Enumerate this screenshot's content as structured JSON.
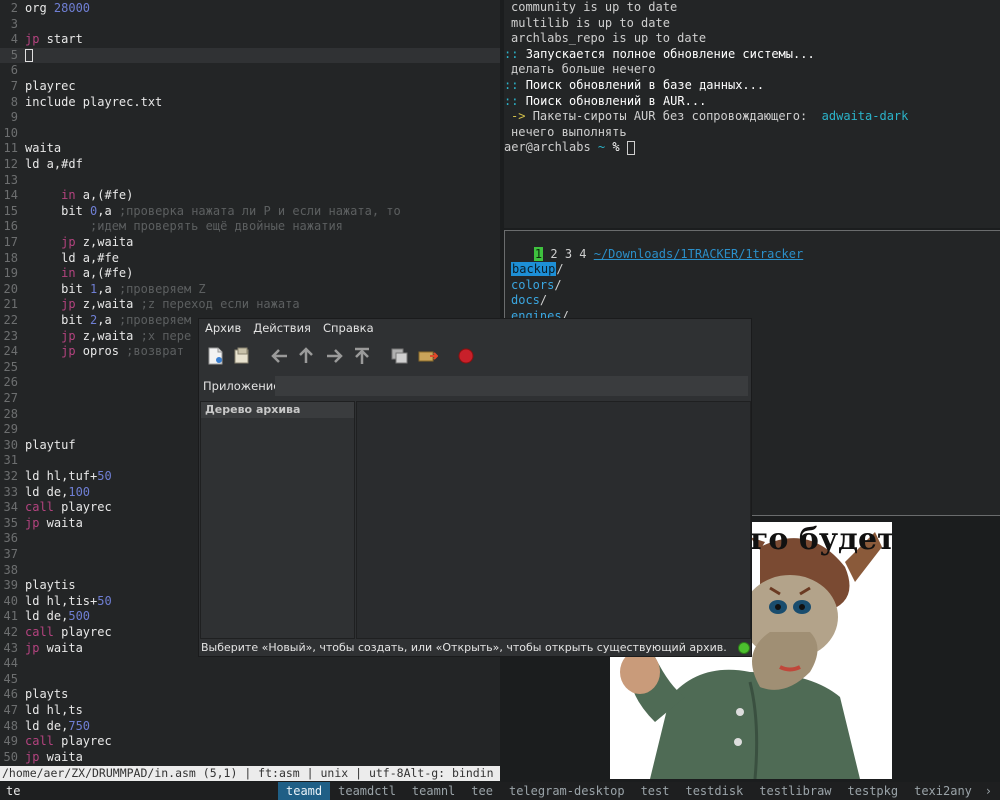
{
  "editor": {
    "lines": [
      {
        "n": "2",
        "parts": [
          [
            "t",
            "org "
          ],
          [
            "num",
            "28000"
          ]
        ]
      },
      {
        "n": "3",
        "parts": []
      },
      {
        "n": "4",
        "parts": [
          [
            "kw",
            "jp"
          ],
          [
            "t",
            " start"
          ]
        ]
      },
      {
        "n": "5",
        "parts": [
          [
            "cursor",
            ""
          ]
        ],
        "current": true
      },
      {
        "n": "6",
        "parts": []
      },
      {
        "n": "7",
        "parts": [
          [
            "t",
            "playrec"
          ]
        ]
      },
      {
        "n": "8",
        "parts": [
          [
            "t",
            "include playrec.txt"
          ]
        ]
      },
      {
        "n": "9",
        "parts": []
      },
      {
        "n": "10",
        "parts": []
      },
      {
        "n": "11",
        "parts": [
          [
            "t",
            "waita"
          ]
        ]
      },
      {
        "n": "12",
        "parts": [
          [
            "t",
            "ld a,#df"
          ]
        ]
      },
      {
        "n": "13",
        "parts": []
      },
      {
        "n": "14",
        "parts": [
          [
            "t",
            "     "
          ],
          [
            "kw",
            "in"
          ],
          [
            "t",
            " a,(#fe)"
          ]
        ]
      },
      {
        "n": "15",
        "parts": [
          [
            "t",
            "     bit "
          ],
          [
            "num",
            "0"
          ],
          [
            "t",
            ",a "
          ],
          [
            "cmt",
            ";проверка нажата ли P и если нажата, то"
          ]
        ]
      },
      {
        "n": "16",
        "parts": [
          [
            "t",
            "         "
          ],
          [
            "cmt",
            ";идем проверять ещё двойные нажатия"
          ]
        ]
      },
      {
        "n": "17",
        "parts": [
          [
            "t",
            "     "
          ],
          [
            "kw",
            "jp"
          ],
          [
            "t",
            " z,waita"
          ]
        ]
      },
      {
        "n": "18",
        "parts": [
          [
            "t",
            "     ld a,#fe"
          ]
        ]
      },
      {
        "n": "19",
        "parts": [
          [
            "t",
            "     "
          ],
          [
            "kw",
            "in"
          ],
          [
            "t",
            " a,(#fe)"
          ]
        ]
      },
      {
        "n": "20",
        "parts": [
          [
            "t",
            "     bit "
          ],
          [
            "num",
            "1"
          ],
          [
            "t",
            ",a "
          ],
          [
            "cmt",
            ";проверяем Z"
          ]
        ]
      },
      {
        "n": "21",
        "parts": [
          [
            "t",
            "     "
          ],
          [
            "kw",
            "jp"
          ],
          [
            "t",
            " z,waita "
          ],
          [
            "cmt",
            ";z переход если нажата"
          ]
        ]
      },
      {
        "n": "22",
        "parts": [
          [
            "t",
            "     bit "
          ],
          [
            "num",
            "2"
          ],
          [
            "t",
            ",a "
          ],
          [
            "cmt",
            ";проверяем"
          ]
        ]
      },
      {
        "n": "23",
        "parts": [
          [
            "t",
            "     "
          ],
          [
            "kw",
            "jp"
          ],
          [
            "t",
            " z,waita "
          ],
          [
            "cmt",
            ";x пере"
          ]
        ]
      },
      {
        "n": "24",
        "parts": [
          [
            "t",
            "     "
          ],
          [
            "kw",
            "jp"
          ],
          [
            "t",
            " opros "
          ],
          [
            "cmt",
            ";возврат"
          ]
        ]
      },
      {
        "n": "25",
        "parts": []
      },
      {
        "n": "26",
        "parts": []
      },
      {
        "n": "27",
        "parts": []
      },
      {
        "n": "28",
        "parts": []
      },
      {
        "n": "29",
        "parts": []
      },
      {
        "n": "30",
        "parts": [
          [
            "t",
            "playtuf"
          ]
        ]
      },
      {
        "n": "31",
        "parts": []
      },
      {
        "n": "32",
        "parts": [
          [
            "t",
            "ld hl,tuf+"
          ],
          [
            "num",
            "50"
          ]
        ]
      },
      {
        "n": "33",
        "parts": [
          [
            "t",
            "ld de,"
          ],
          [
            "num",
            "100"
          ]
        ]
      },
      {
        "n": "34",
        "parts": [
          [
            "kw",
            "call"
          ],
          [
            "t",
            " playrec"
          ]
        ]
      },
      {
        "n": "35",
        "parts": [
          [
            "kw",
            "jp"
          ],
          [
            "t",
            " waita"
          ]
        ]
      },
      {
        "n": "36",
        "parts": []
      },
      {
        "n": "37",
        "parts": []
      },
      {
        "n": "38",
        "parts": []
      },
      {
        "n": "39",
        "parts": [
          [
            "t",
            "playtis"
          ]
        ]
      },
      {
        "n": "40",
        "parts": [
          [
            "t",
            "ld hl,tis+"
          ],
          [
            "num",
            "50"
          ]
        ]
      },
      {
        "n": "41",
        "parts": [
          [
            "t",
            "ld de,"
          ],
          [
            "num",
            "500"
          ]
        ]
      },
      {
        "n": "42",
        "parts": [
          [
            "kw",
            "call"
          ],
          [
            "t",
            " playrec"
          ]
        ]
      },
      {
        "n": "43",
        "parts": [
          [
            "kw",
            "jp"
          ],
          [
            "t",
            " waita"
          ]
        ]
      },
      {
        "n": "44",
        "parts": []
      },
      {
        "n": "45",
        "parts": []
      },
      {
        "n": "46",
        "parts": [
          [
            "t",
            "playts"
          ]
        ]
      },
      {
        "n": "47",
        "parts": [
          [
            "t",
            "ld hl,ts"
          ]
        ]
      },
      {
        "n": "48",
        "parts": [
          [
            "t",
            "ld de,"
          ],
          [
            "num",
            "750"
          ]
        ]
      },
      {
        "n": "49",
        "parts": [
          [
            "kw",
            "call"
          ],
          [
            "t",
            " playrec"
          ]
        ]
      },
      {
        "n": "50",
        "parts": [
          [
            "kw",
            "jp"
          ],
          [
            "t",
            " waita"
          ]
        ]
      }
    ],
    "status": "/home/aer/ZX/DRUMMPAD/in.asm (5,1) | ft:asm | unix | utf-8Alt-g: bindin"
  },
  "bottombar": {
    "command": "te",
    "tags": [
      "teamd",
      "teamdctl",
      "teamnl",
      "tee",
      "telegram-desktop",
      "test",
      "testdisk",
      "testlibraw",
      "testpkg",
      "texi2any"
    ],
    "active_tag": 0,
    "more": "›"
  },
  "terminal": {
    "lines": [
      {
        "cls": "ind",
        "parts": [
          [
            "t",
            "community is up to date"
          ]
        ]
      },
      {
        "cls": "ind",
        "parts": [
          [
            "t",
            "multilib is up to date"
          ]
        ]
      },
      {
        "cls": "ind",
        "parts": [
          [
            "t",
            "archlabs_repo is up to date"
          ]
        ]
      },
      {
        "cls": "",
        "parts": [
          [
            "cy",
            ":: "
          ],
          [
            "wb",
            "Запускается полное обновление системы..."
          ]
        ]
      },
      {
        "cls": "ind",
        "parts": [
          [
            "t",
            "делать больше нечего"
          ]
        ]
      },
      {
        "cls": "",
        "parts": [
          [
            "cy",
            ":: "
          ],
          [
            "wb",
            "Поиск обновлений в базе данных..."
          ]
        ]
      },
      {
        "cls": "",
        "parts": [
          [
            "cy",
            ":: "
          ],
          [
            "wb",
            "Поиск обновлений в AUR..."
          ]
        ]
      },
      {
        "cls": "ind",
        "parts": [
          [
            "ar",
            "-> "
          ],
          [
            "t",
            "Пакеты-сироты AUR без сопровождающего:  "
          ],
          [
            "cy",
            "adwaita-dark"
          ]
        ]
      },
      {
        "cls": "ind",
        "parts": [
          [
            "t",
            "нечего выполнять"
          ]
        ]
      },
      {
        "cls": "",
        "parts": [
          [
            "t",
            "aer@archlabs "
          ],
          [
            "cy",
            "~"
          ],
          [
            "wb",
            " % "
          ],
          [
            "tcur",
            ""
          ]
        ]
      }
    ]
  },
  "ranger": {
    "tab_active": "1",
    "tabs_rest": " 2 3 4 ",
    "path": "~/Downloads/1TRACKER/1tracker",
    "dirs": [
      "backup",
      "colors",
      "docs",
      "engines"
    ]
  },
  "image_viewer": {
    "caption": "го будет!"
  },
  "archive_manager": {
    "menu": [
      "Архив",
      "Действия",
      "Справка"
    ],
    "app_label": "Приложение:",
    "tree_header": "Дерево архива",
    "status": "Выберите «Новый», чтобы создать, или «Открыть», чтобы открыть существующий архив."
  }
}
